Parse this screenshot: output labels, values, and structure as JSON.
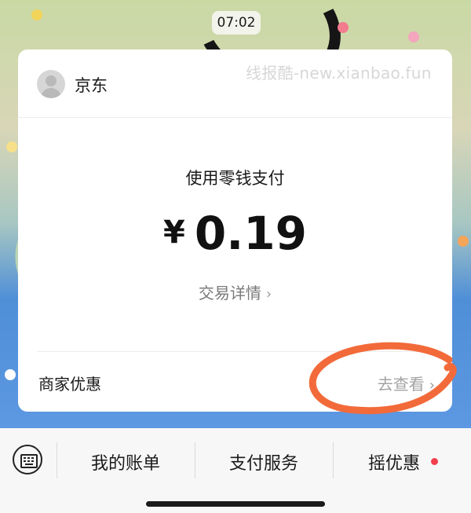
{
  "status": {
    "time": "07:02"
  },
  "watermark": "线报酷-new.xianbao.fun",
  "merchant": {
    "name": "京东",
    "icon": "avatar-placeholder-icon"
  },
  "payment": {
    "method_label": "使用零钱支付",
    "currency": "¥",
    "amount": "0.19",
    "details_label": "交易详情"
  },
  "promo": {
    "label": "商家优惠",
    "link_label": "去查看"
  },
  "toolbar": {
    "keyboard_icon": "keyboard-icon",
    "items": [
      {
        "label": "我的账单"
      },
      {
        "label": "支付服务"
      },
      {
        "label": "摇优惠",
        "badge": true
      }
    ]
  },
  "colors": {
    "annotation": "#f26a3a",
    "badge": "#f0404d",
    "card": "#ffffff",
    "muted_text": "#7a7a7a"
  }
}
